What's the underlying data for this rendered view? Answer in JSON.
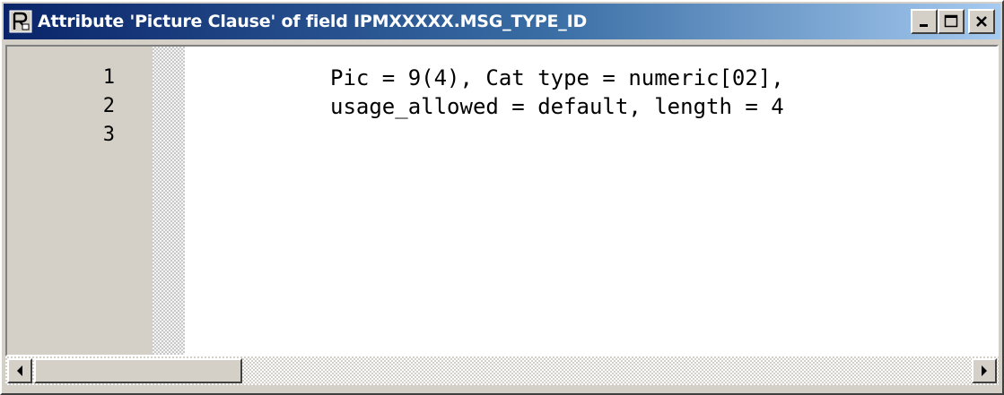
{
  "window": {
    "title": "Attribute 'Picture Clause' of field IPMXXXXX.MSG_TYPE_ID",
    "app_icon": "object-browser-icon",
    "controls": {
      "minimize_icon": "minimize-icon",
      "maximize_icon": "maximize-icon",
      "close_icon": "close-icon"
    }
  },
  "editor": {
    "lines": [
      {
        "number": "1",
        "text": "Pic = 9(4), Cat type = numeric[02],"
      },
      {
        "number": "2",
        "text": "usage_allowed = default, length = 4"
      },
      {
        "number": "3",
        "text": ""
      }
    ]
  },
  "scrollbar": {
    "left_icon": "arrow-left-icon",
    "right_icon": "arrow-right-icon",
    "position": 0
  },
  "colors": {
    "title_gradient_start": "#0a246a",
    "title_gradient_end": "#a6caf0",
    "face": "#d4d0c8"
  }
}
